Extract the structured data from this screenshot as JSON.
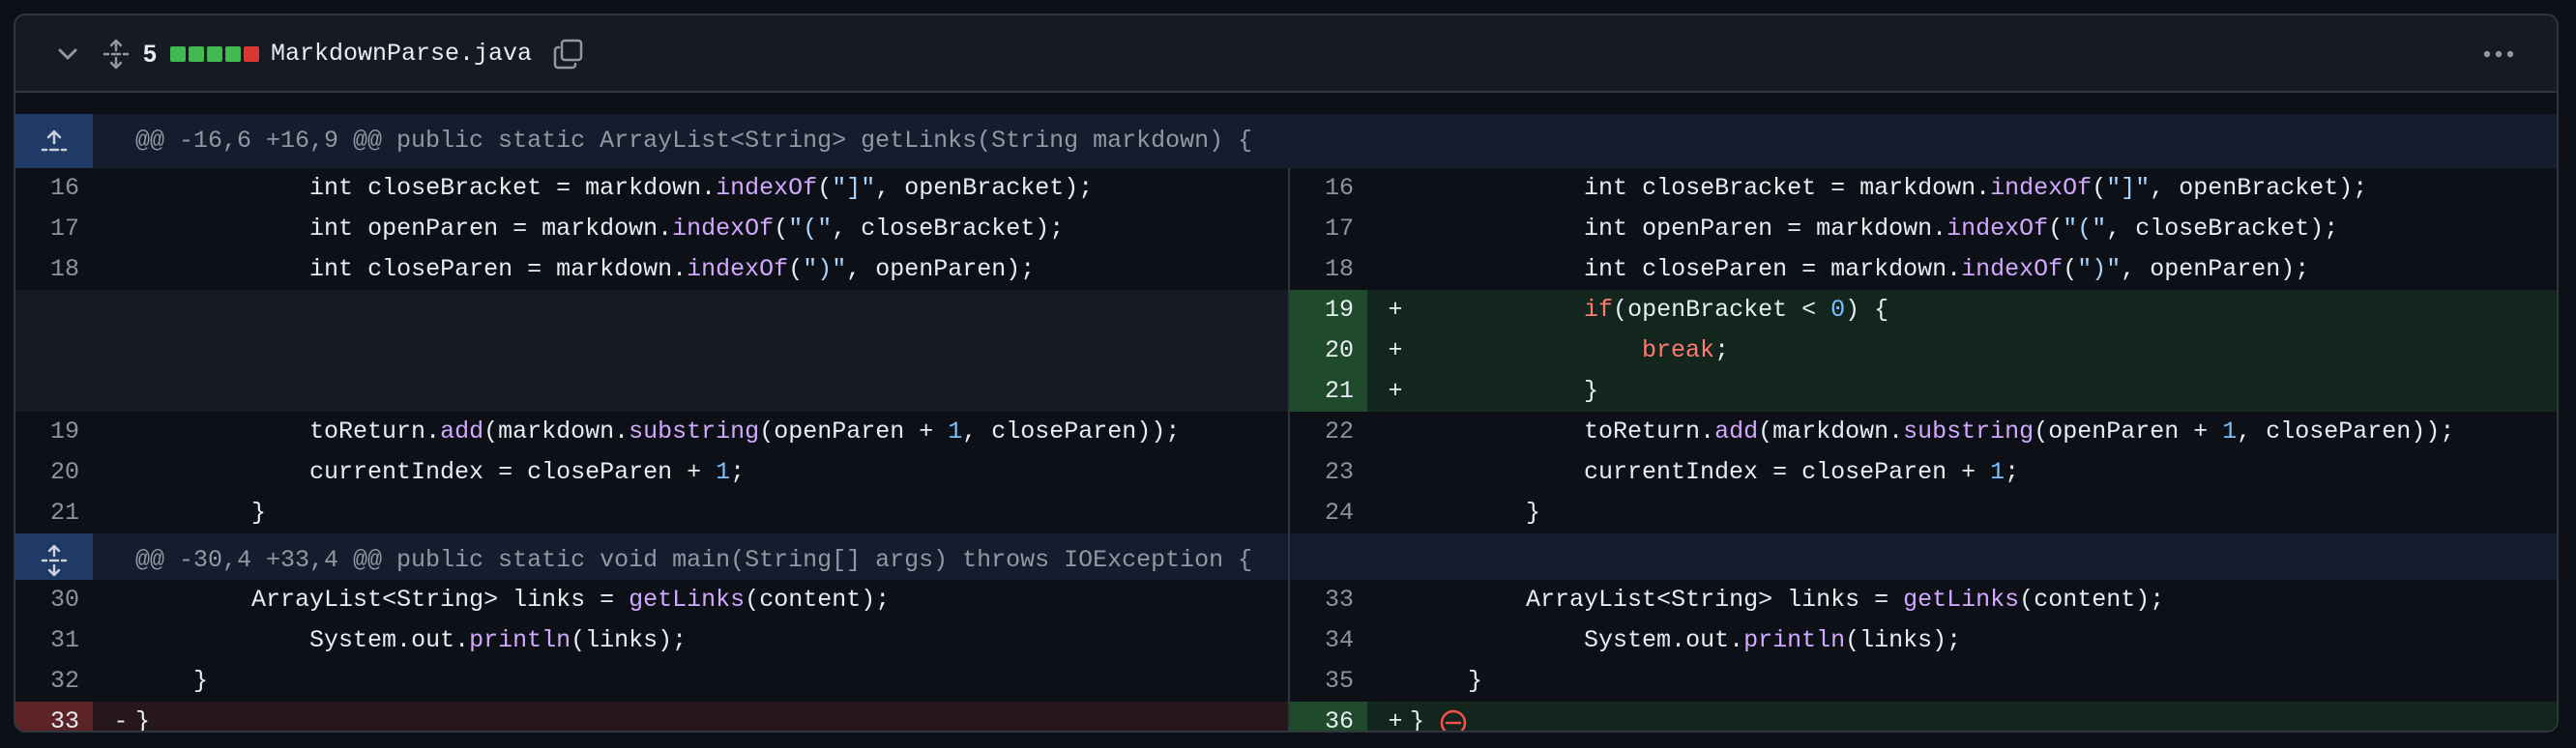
{
  "file": {
    "changes_count": "5",
    "name": "MarkdownParse.java",
    "diffstat": [
      "#3fb950",
      "#3fb950",
      "#3fb950",
      "#3fb950",
      "#da3633"
    ]
  },
  "hunks": [
    {
      "header": "@@ -16,6 +16,9 @@ public static ArrayList<String> getLinks(String markdown) {"
    },
    {
      "header": "@@ -30,4 +33,4 @@ public static void main(String[] args) throws IOException {"
    }
  ],
  "icons": {
    "collapse": "chevron-down-icon",
    "expand_all": "unfold-icon",
    "copy": "copy-icon",
    "kebab": "kebab-horizontal-icon",
    "hunk_expand_up": "expand-up-icon",
    "hunk_expand": "unfold-icon",
    "no_newline": "no-entry-icon"
  },
  "colors": {
    "added_bg": "#12261e",
    "added_num_bg": "#1f4a2c",
    "deleted_bg": "#25171c",
    "deleted_num_bg": "#5c2426",
    "hunk_bg": "#131d2e"
  },
  "rows": [
    {
      "l": {
        "num": "16",
        "marker": "",
        "text": "            int closeBracket = markdown.indexOf(\"]\", openBracket);"
      },
      "r": {
        "num": "16",
        "marker": "",
        "text": "            int closeBracket = markdown.indexOf(\"]\", openBracket);"
      }
    },
    {
      "l": {
        "num": "17",
        "marker": "",
        "text": "            int openParen = markdown.indexOf(\"(\", closeBracket);"
      },
      "r": {
        "num": "17",
        "marker": "",
        "text": "            int openParen = markdown.indexOf(\"(\", closeBracket);"
      }
    },
    {
      "l": {
        "num": "18",
        "marker": "",
        "text": "            int closeParen = markdown.indexOf(\")\", openParen);"
      },
      "r": {
        "num": "18",
        "marker": "",
        "text": "            int closeParen = markdown.indexOf(\")\", openParen);"
      }
    },
    {
      "l": null,
      "r": {
        "num": "19",
        "marker": "+",
        "text": "            if(openBracket < 0) {"
      }
    },
    {
      "l": null,
      "r": {
        "num": "20",
        "marker": "+",
        "text": "                break;"
      }
    },
    {
      "l": null,
      "r": {
        "num": "21",
        "marker": "+",
        "text": "            }"
      }
    },
    {
      "l": {
        "num": "19",
        "marker": "",
        "text": "            toReturn.add(markdown.substring(openParen + 1, closeParen));"
      },
      "r": {
        "num": "22",
        "marker": "",
        "text": "            toReturn.add(markdown.substring(openParen + 1, closeParen));"
      }
    },
    {
      "l": {
        "num": "20",
        "marker": "",
        "text": "            currentIndex = closeParen + 1;"
      },
      "r": {
        "num": "23",
        "marker": "",
        "text": "            currentIndex = closeParen + 1;"
      }
    },
    {
      "l": {
        "num": "21",
        "marker": "",
        "text": "        }"
      },
      "r": {
        "num": "24",
        "marker": "",
        "text": "        }"
      }
    },
    {
      "l": {
        "num": "30",
        "marker": "",
        "text": "        ArrayList<String> links = getLinks(content);"
      },
      "r": {
        "num": "33",
        "marker": "",
        "text": "        ArrayList<String> links = getLinks(content);"
      }
    },
    {
      "l": {
        "num": "31",
        "marker": "",
        "text": "            System.out.println(links);"
      },
      "r": {
        "num": "34",
        "marker": "",
        "text": "            System.out.println(links);"
      }
    },
    {
      "l": {
        "num": "32",
        "marker": "",
        "text": "    }"
      },
      "r": {
        "num": "35",
        "marker": "",
        "text": "    }"
      }
    },
    {
      "l": {
        "num": "33",
        "marker": "-",
        "text": "}"
      },
      "r": {
        "num": "36",
        "marker": "+",
        "text": "}"
      }
    }
  ]
}
